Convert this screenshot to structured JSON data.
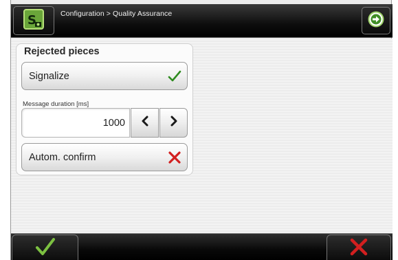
{
  "header": {
    "breadcrumb": "Configuration > Quality Assurance",
    "logo_icon": "machine-logo-icon",
    "next_icon": "arrow-right-circle-icon"
  },
  "panel": {
    "title": "Rejected pieces",
    "signalize": {
      "label": "Signalize",
      "state": "on",
      "state_icon": "checkmark-icon"
    },
    "message_duration": {
      "label": "Message duration [ms]",
      "value": "1000"
    },
    "autom_confirm": {
      "label": "Autom. confirm",
      "state": "off",
      "state_icon": "cross-icon"
    }
  },
  "footer": {
    "confirm_icon": "checkmark-icon",
    "cancel_icon": "cross-icon"
  },
  "colors": {
    "accent_green": "#2e8b1f",
    "logo_green": "#8bc34a",
    "cancel_red": "#d21f1f"
  }
}
